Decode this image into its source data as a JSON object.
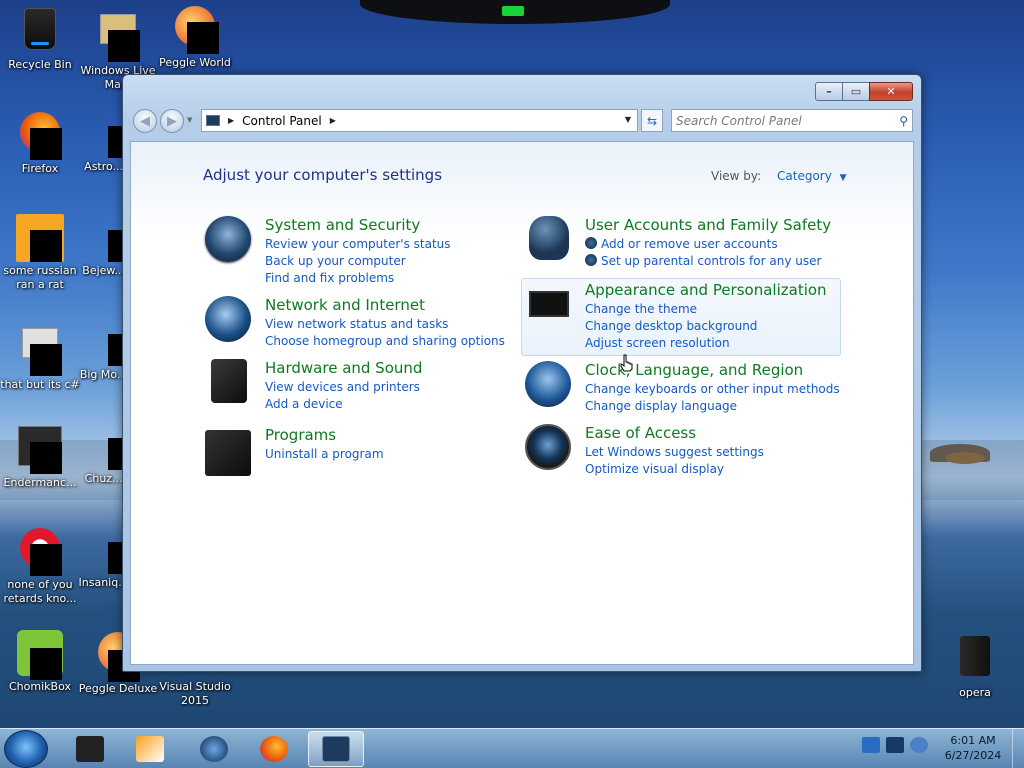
{
  "desktop": {
    "icons": [
      {
        "label": "Recycle Bin"
      },
      {
        "label": "Windows Live Ma..."
      },
      {
        "label": "Peggle World"
      },
      {
        "label": "Firefox"
      },
      {
        "label": "Astro... Delu"
      },
      {
        "label": "some russian ran a rat"
      },
      {
        "label": "Bejew... Delu"
      },
      {
        "label": "that but its c#"
      },
      {
        "label": "Big Mo... Delu"
      },
      {
        "label": "Endermanc..."
      },
      {
        "label": "Chuz... Delu"
      },
      {
        "label": "none of you retards kno..."
      },
      {
        "label": "Insaniq... Delu"
      },
      {
        "label": "ChomikBox"
      },
      {
        "label": "Peggle Deluxe"
      },
      {
        "label": "Visual Studio 2015"
      },
      {
        "label": "opera"
      }
    ]
  },
  "window": {
    "caption": {
      "minimize": "–",
      "maximize": "▭",
      "close": "✕"
    },
    "address": {
      "root": "Control Panel"
    },
    "search": {
      "placeholder": "Search Control Panel"
    },
    "heading": "Adjust your computer's settings",
    "view_by": {
      "label": "View by:",
      "value": "Category"
    },
    "categories": [
      {
        "title": "System and Security",
        "links": [
          "Review your computer's status",
          "Back up your computer",
          "Find and fix problems"
        ]
      },
      {
        "title": "Network and Internet",
        "links": [
          "View network status and tasks",
          "Choose homegroup and sharing options"
        ]
      },
      {
        "title": "Hardware and Sound",
        "links": [
          "View devices and printers",
          "Add a device"
        ]
      },
      {
        "title": "Programs",
        "links": [
          "Uninstall a program"
        ]
      },
      {
        "title": "User Accounts and Family Safety",
        "links": [
          "Add or remove user accounts",
          "Set up parental controls for any user"
        ]
      },
      {
        "title": "Appearance and Personalization",
        "links": [
          "Change the theme",
          "Change desktop background",
          "Adjust screen resolution"
        ]
      },
      {
        "title": "Clock, Language, and Region",
        "links": [
          "Change keyboards or other input methods",
          "Change display language"
        ]
      },
      {
        "title": "Ease of Access",
        "links": [
          "Let Windows suggest settings",
          "Optimize visual display"
        ]
      }
    ]
  },
  "taskbar": {
    "time": "6:01 AM",
    "date": "6/27/2024"
  },
  "colors": {
    "link": "#1459c4",
    "category_title": "#0e7a1f",
    "heading": "#1e3287"
  }
}
